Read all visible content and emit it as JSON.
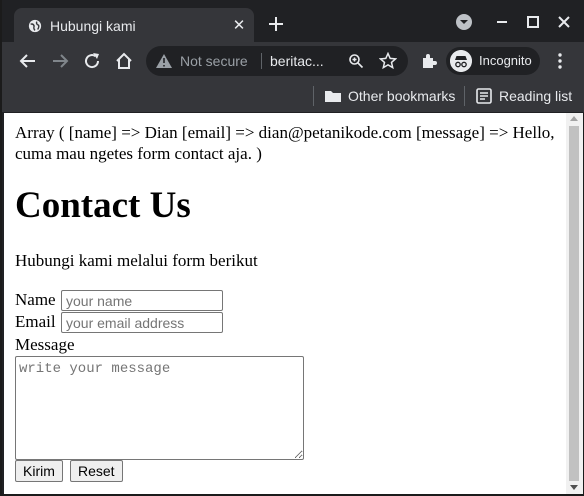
{
  "browser": {
    "tab_title": "Hubungi kami",
    "security_label": "Not secure",
    "url": "beritac...",
    "profile_label": "Incognito",
    "bookmarks": [
      {
        "label": "Other bookmarks",
        "icon": "folder-icon"
      },
      {
        "label": "Reading list",
        "icon": "reading-list-icon"
      }
    ]
  },
  "page": {
    "dump_text": "Array ( [name] => Dian [email] => dian@petanikode.com [message] => Hello, cuma mau ngetes form contact aja. )",
    "heading": "Contact Us",
    "intro": "Hubungi kami melalui form berikut",
    "form": {
      "name_label": "Name",
      "name_placeholder": "your name",
      "email_label": "Email",
      "email_placeholder": "your email address",
      "message_label": "Message",
      "message_placeholder": "write your message",
      "submit_label": "Kirim",
      "reset_label": "Reset"
    }
  }
}
